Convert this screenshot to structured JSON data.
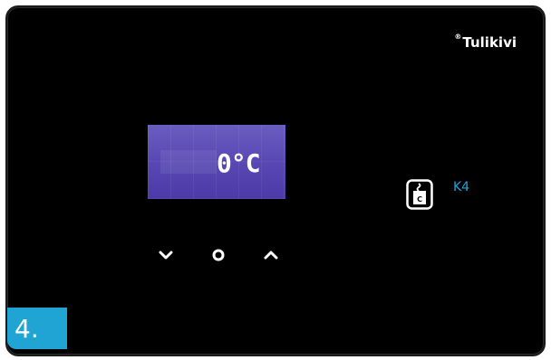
{
  "brand": {
    "name": "Tulikivi",
    "registered_mark": "®"
  },
  "display": {
    "value": "0°C"
  },
  "controls": {
    "down_icon": "chevron-down-icon",
    "ok_icon": "circle-dot-icon",
    "up_icon": "chevron-up-icon"
  },
  "mode": {
    "icon": "k4-sauna-mode-icon",
    "label": "K4",
    "color": "#1aa6d8"
  },
  "step": {
    "label": "4.",
    "color": "#20a4d4"
  },
  "display_colors": {
    "lcd_background": "#5948b3",
    "text": "#ffffff"
  }
}
